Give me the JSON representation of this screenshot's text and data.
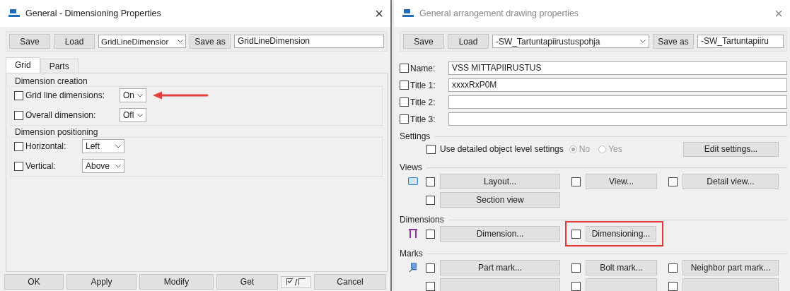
{
  "left_window": {
    "title": "General - Dimensioning Properties",
    "close": "×",
    "toolbar": {
      "buttons": [
        "Save",
        "Load"
      ],
      "preset": "GridLineDimensior",
      "save_as": "Save as",
      "name": "GridLineDimension"
    },
    "tabs": [
      {
        "label": "Grid",
        "selected": true
      },
      {
        "label": "Parts",
        "selected": false
      }
    ],
    "groups": [
      {
        "title": "Dimension creation",
        "rows": [
          {
            "label": "Grid line dimensions:",
            "checked": false,
            "value": "On",
            "pointed": true
          },
          {
            "label": "Overall dimension:",
            "checked": false,
            "value": "Ofl",
            "pointed": false
          }
        ]
      },
      {
        "title": "Dimension positioning",
        "rows": [
          {
            "label": "Horizontal:",
            "checked": false,
            "value": "Left",
            "pointed": false
          },
          {
            "label": "Vertical:",
            "checked": false,
            "value": "Above",
            "pointed": false
          }
        ]
      }
    ],
    "bottom_buttons": [
      {
        "kind": "text",
        "label": "OK"
      },
      {
        "kind": "text",
        "label": "Apply"
      },
      {
        "kind": "text",
        "label": "Modify"
      },
      {
        "kind": "text",
        "label": "Get"
      },
      {
        "kind": "toggle",
        "label": "/"
      },
      {
        "kind": "text",
        "label": "Cancel"
      }
    ]
  },
  "right_window": {
    "title": "General arrangement drawing properties",
    "close": "×",
    "toolbar": {
      "buttons": [
        "Save",
        "Load"
      ],
      "preset": "-SW_Tartuntapiirustuspohja",
      "save_as": "Save as",
      "name": "-SW_Tartuntapiiru"
    },
    "fields": [
      {
        "label": "Name:",
        "checked": false,
        "value": "VSS MITTAPIIRUSTUS"
      },
      {
        "label": "Title 1:",
        "checked": false,
        "value": "xxxxRxP0M"
      },
      {
        "label": "Title 2:",
        "checked": false
      },
      {
        "label": "Title 3:",
        "checked": false
      }
    ],
    "settings": {
      "title": "Settings",
      "checkbox_label": "Use detailed object level settings",
      "checked": false,
      "disabled": true,
      "options": [
        {
          "label": "No",
          "selected": true
        },
        {
          "label": "Yes",
          "selected": false
        }
      ],
      "button": "Edit settings..."
    },
    "sections": [
      {
        "title": "Views",
        "kind": "views",
        "rows": [
          [
            {
              "label": "Layout...",
              "checked": false,
              "highlighted": false
            },
            {
              "label": "View...",
              "checked": false,
              "highlighted": false
            },
            {
              "label": "Detail view...",
              "checked": false,
              "highlighted": false
            }
          ],
          [
            {
              "label": "Section view",
              "checked": false,
              "highlighted": false
            }
          ]
        ]
      },
      {
        "title": "Dimensions",
        "kind": "dimensions",
        "rows": [
          [
            {
              "label": "Dimension...",
              "checked": false,
              "highlighted": false
            },
            {
              "label": "Dimensioning...",
              "checked": false,
              "highlighted": true
            }
          ]
        ]
      },
      {
        "title": "Marks",
        "kind": "marks",
        "rows": [
          [
            {
              "label": "Part mark...",
              "checked": false,
              "highlighted": false
            },
            {
              "label": "Bolt mark...",
              "checked": false,
              "highlighted": false
            },
            {
              "label": "Neighbor part mark...",
              "checked": false,
              "highlighted": false
            }
          ],
          [
            {
              "checked": false,
              "highlighted": false
            },
            {
              "checked": false,
              "highlighted": false
            },
            {
              "checked": false,
              "highlighted": false
            }
          ]
        ]
      }
    ]
  }
}
